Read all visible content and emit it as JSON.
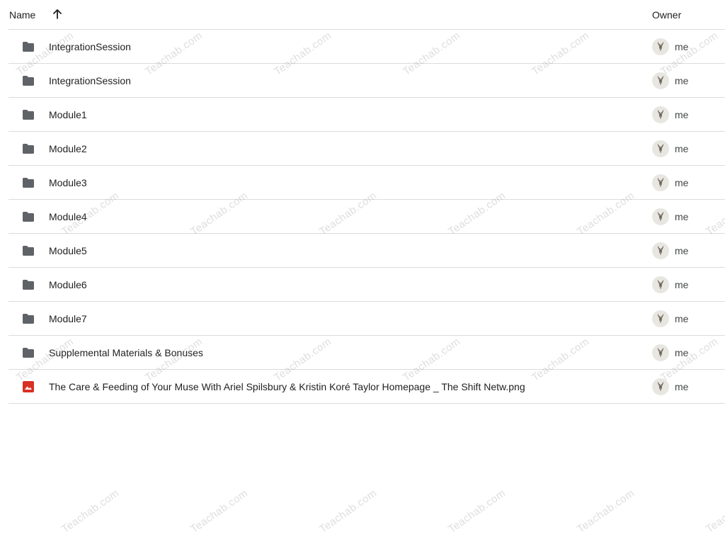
{
  "header": {
    "name_label": "Name",
    "owner_label": "Owner",
    "sort_direction": "ascending"
  },
  "files": [
    {
      "name": "IntegrationSession",
      "type": "folder",
      "owner": "me"
    },
    {
      "name": "IntegrationSession",
      "type": "folder",
      "owner": "me"
    },
    {
      "name": "Module1",
      "type": "folder",
      "owner": "me"
    },
    {
      "name": "Module2",
      "type": "folder",
      "owner": "me"
    },
    {
      "name": "Module3",
      "type": "folder",
      "owner": "me"
    },
    {
      "name": "Module4",
      "type": "folder",
      "owner": "me"
    },
    {
      "name": "Module5",
      "type": "folder",
      "owner": "me"
    },
    {
      "name": "Module6",
      "type": "folder",
      "owner": "me"
    },
    {
      "name": "Module7",
      "type": "folder",
      "owner": "me"
    },
    {
      "name": "Supplemental Materials & Bonuses",
      "type": "folder",
      "owner": "me"
    },
    {
      "name": "The Care & Feeding of Your Muse With Ariel Spilsbury & Kristin Koré Taylor Homepage _ The Shift Netw.png",
      "type": "image",
      "owner": "me"
    }
  ],
  "watermark": {
    "text": "Teachab.com"
  },
  "colors": {
    "folder_icon": "#5f6368",
    "image_icon": "#d93025",
    "divider": "#dadce0",
    "avatar_bg": "#e8e6e1"
  }
}
